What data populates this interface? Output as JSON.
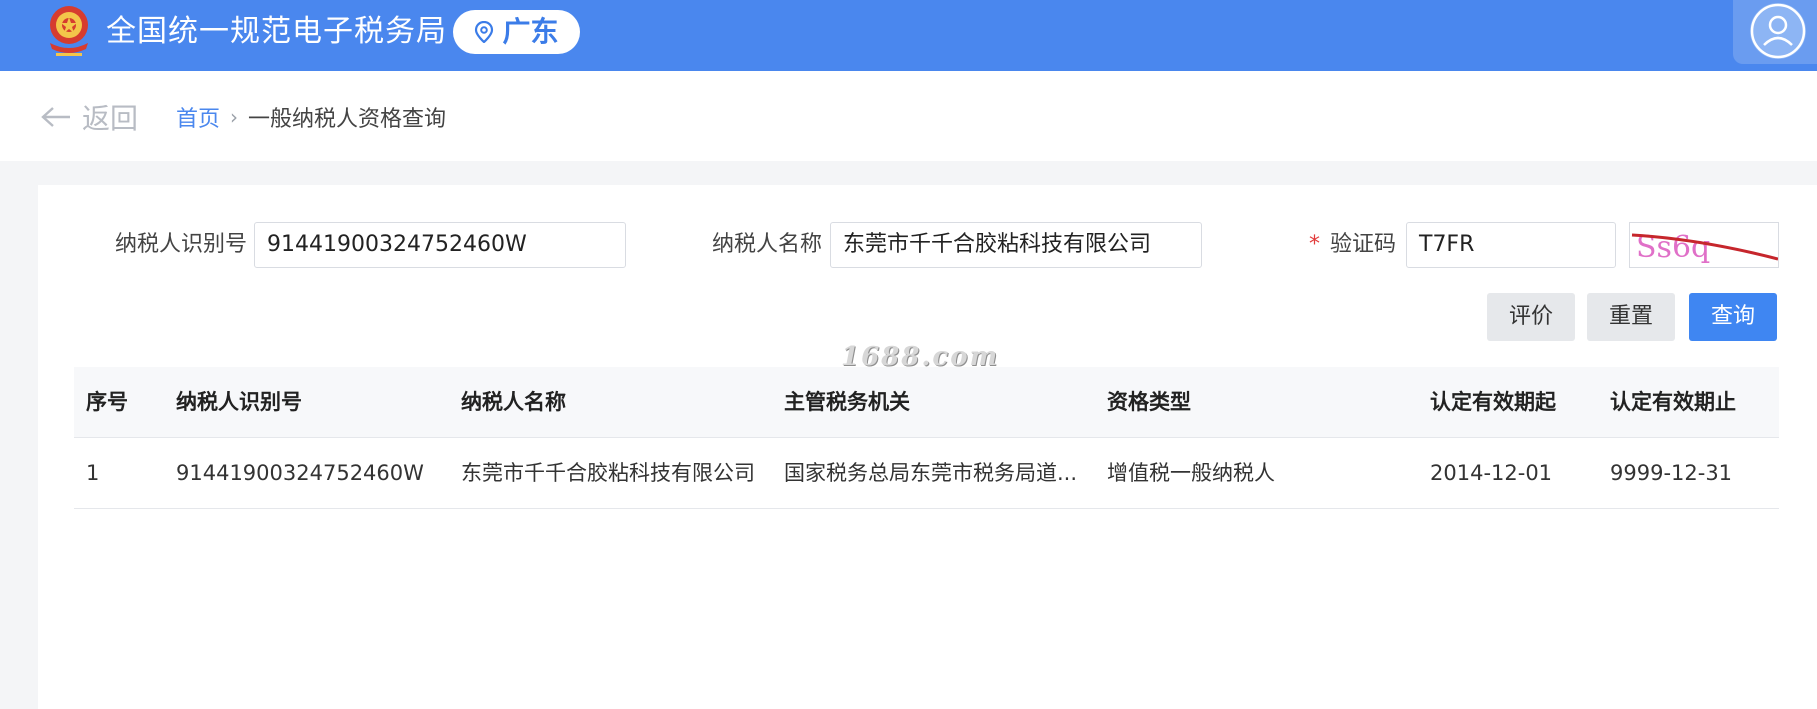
{
  "header": {
    "title": "全国统一规范电子税务局",
    "region": "广东",
    "emblem_icon": "tax-emblem-icon",
    "user_icon": "user-avatar-icon",
    "bar_color": "#4a87ee"
  },
  "breadcrumb": {
    "back_label": "返回",
    "home": "首页",
    "current": "一般纳税人资格查询"
  },
  "form": {
    "taxpayer_id_label": "纳税人识别号",
    "taxpayer_id_value": "91441900324752460W",
    "taxpayer_name_label": "纳税人名称",
    "taxpayer_name_value": "东莞市千千合胶粘科技有限公司",
    "captcha_label": "验证码",
    "captcha_required_mark": "*",
    "captcha_value": "T7FR",
    "captcha_image_text": "Ss6q"
  },
  "buttons": {
    "evaluate": "评价",
    "reset": "重置",
    "query": "查询",
    "primary_color": "#3f86f2"
  },
  "watermark": "1688.com",
  "table": {
    "columns": [
      "序号",
      "纳税人识别号",
      "纳税人名称",
      "主管税务机关",
      "资格类型",
      "认定有效期起",
      "认定有效期止"
    ],
    "rows": [
      [
        "1",
        "91441900324752460W",
        "东莞市千千合胶粘科技有限公司",
        "国家税务总局东莞市税务局道...",
        "增值税一般纳税人",
        "2014-12-01",
        "9999-12-31"
      ]
    ]
  }
}
